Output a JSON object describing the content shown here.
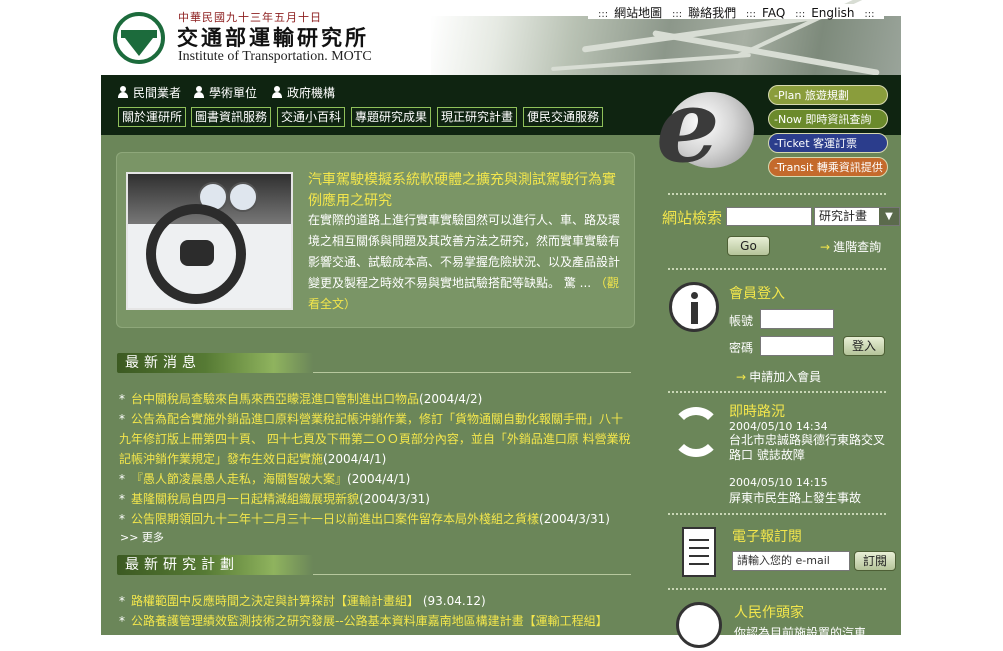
{
  "header": {
    "date": "中華民國九十三年五月十日",
    "org_cn": "交通部運輸研究所",
    "org_en": "Institute of Transportation. MOTC",
    "top_links": [
      "網站地圖",
      "聯絡我們",
      "FAQ",
      "English"
    ]
  },
  "roles": [
    "民間業者",
    "學術單位",
    "政府機構"
  ],
  "nav": [
    "關於運研所",
    "圖書資訊服務",
    "交通小百科",
    "專題研究成果",
    "現正研究計畫",
    "便民交通服務"
  ],
  "e_services": [
    {
      "label": "-Plan 旅遊規劃",
      "color": "#8a9d3c"
    },
    {
      "label": "-Now 即時資訊查詢",
      "color": "#6b8a2c"
    },
    {
      "label": "-Ticket 客運訂票",
      "color": "#2b3d8c"
    },
    {
      "label": "-Transit 轉乘資訊提供",
      "color": "#c46a2c"
    }
  ],
  "feature": {
    "title": "汽車駕駛模擬系統軟硬體之擴充與測試駕駛行為實例應用之研究",
    "body": "在實際的道路上進行實車實驗固然可以進行人、車、路及環境之相互關係與問題及其改善方法之研究，然而實車實驗有影響交通、試驗成本高、不易掌握危險狀況、以及產品設計變更及製程之時效不易與實地試驗搭配等缺點。 驚 ...",
    "more": "（觀看全文）"
  },
  "news": {
    "header": "最新消息",
    "items": [
      {
        "text": "台中關稅局查驗來自馬來西亞矇混進口管制進出口物品",
        "date": "(2004/4/2)"
      },
      {
        "text": "公告為配合實施外銷品進口原料營業稅記帳沖銷作業，修訂「貨物通關自動化報關手冊」八十九年修訂版上冊第四十頁、 四十七頁及下冊第二ＯＯ頁部分內容，並自「外銷品進口原 料營業稅記帳沖銷作業規定」發布生效日起實施",
        "date": "(2004/4/1)"
      },
      {
        "text": "『愚人節凌晨愚人走私，海關智破大案』",
        "date": "(2004/4/1)"
      },
      {
        "text": "基隆關稅局自四月一日起精減組織展現新貌",
        "date": "(2004/3/31)"
      },
      {
        "text": "公告限期領回九十二年十二月三十一日以前進出口案件留存本局外棧組之貨樣",
        "date": "(2004/3/31)"
      }
    ],
    "more": ">> 更多"
  },
  "plans": {
    "header": "最新研究計劃",
    "items": [
      {
        "text": "路權範圍中反應時間之決定與計算探討【運輸計畫組】",
        "date": "(93.04.12)"
      },
      {
        "text": "公路養護管理績效監測技術之研究發展--公路基本資料庫嘉南地區構建計畫【運輸工程組】",
        "date": "(93.04.03)"
      }
    ]
  },
  "search": {
    "label": "網站檢索",
    "value": "",
    "select_value": "研究計畫",
    "go": "Go",
    "advanced": "進階查詢"
  },
  "login": {
    "title": "會員登入",
    "account_label": "帳號",
    "password_label": "密碼",
    "login_button": "登入",
    "join": "申請加入會員"
  },
  "traffic": {
    "title": "即時路況",
    "items": [
      {
        "time": "2004/05/10 14:34",
        "text": "台北市忠誠路與德行東路交叉路口 號誌故障"
      },
      {
        "time": "2004/05/10 14:15",
        "text": "屏東市民生路上發生事故"
      }
    ]
  },
  "newsletter": {
    "title": "電子報訂閱",
    "placeholder": "請輸入您的 e-mail",
    "button": "訂閱"
  },
  "citizen": {
    "title": "人民作頭家",
    "text": "你認為目前施設置的汽車"
  }
}
